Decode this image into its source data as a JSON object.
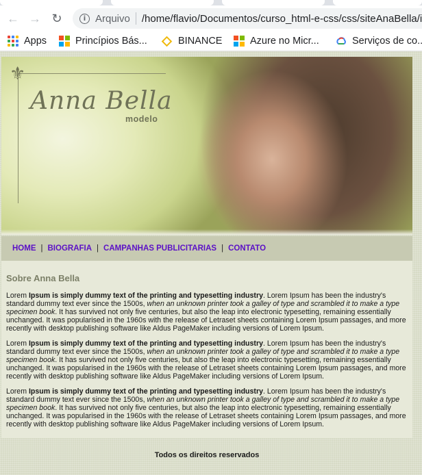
{
  "browser": {
    "url_scheme": "Arquivo",
    "url": "/home/flavio/Documentos/curso_html-e-css/css/siteAnaBella/ind"
  },
  "bookmarks": {
    "items": [
      {
        "label": "Apps",
        "icon": "apps-grid-icon"
      },
      {
        "label": "Princípios Bás...",
        "icon": "microsoft-logo-icon"
      },
      {
        "label": "BINANCE",
        "icon": "binance-logo-icon"
      },
      {
        "label": "Azure no Micr...",
        "icon": "microsoft-logo-icon"
      },
      {
        "label": "Serviços de co...",
        "icon": "google-cloud-icon"
      }
    ]
  },
  "site": {
    "brand": "Anna Bella",
    "brand_sub": "modelo",
    "menu": [
      "HOME",
      "BIOGRAFIA",
      "CAMPANHAS PUBLICITARIAS",
      "CONTATO"
    ],
    "menu_separator": "|",
    "section_title": "Sobre Anna Bella",
    "paragraph": {
      "lead": "Lorem ",
      "bold": "Ipsum is simply dummy text of the printing and typesetting industry",
      "mid": ". Lorem Ipsum has been the industry's standard dummy text ever since the 1500s, ",
      "italic": "when an unknown printer took a galley of type and scrambled it to make a type specimen book",
      "tail": ". It has survived not only five centuries, but also the leap into electronic typesetting, remaining essentially unchanged. It was popularised in the 1960s with the release of Letraset sheets containing Lorem Ipsum passages, and more recently with desktop publishing software like Aldus PageMaker including versions of Lorem Ipsum."
    },
    "footer": "Todos os direitos reservados"
  },
  "colors": {
    "menu_link": "#5b10c6",
    "menu_bg": "#c7cab2",
    "content_bg": "#e7e9d9",
    "section_title": "#7b7f67"
  }
}
